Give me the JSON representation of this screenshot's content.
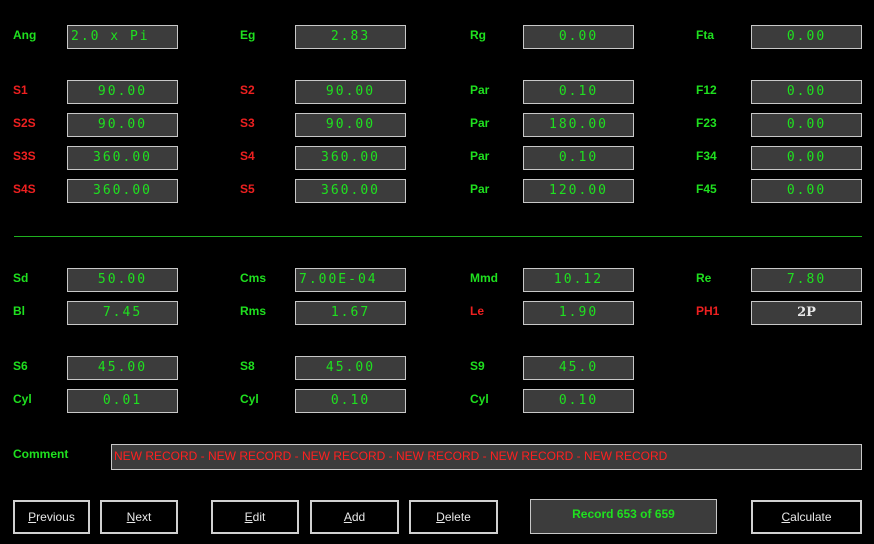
{
  "params": {
    "ang": {
      "label": "Ang",
      "value": "2.0 x Pi"
    },
    "eg": {
      "label": "Eg",
      "value": "2.83"
    },
    "rg": {
      "label": "Rg",
      "value": "0.00"
    },
    "fta": {
      "label": "Fta",
      "value": "0.00"
    },
    "s1": {
      "label": "S1",
      "value": "90.00"
    },
    "s2": {
      "label": "S2",
      "value": "90.00"
    },
    "par1": {
      "label": "Par",
      "value": "0.10"
    },
    "f12": {
      "label": "F12",
      "value": "0.00"
    },
    "s2s": {
      "label": "S2S",
      "value": "90.00"
    },
    "s3": {
      "label": "S3",
      "value": "90.00"
    },
    "par2": {
      "label": "Par",
      "value": "180.00"
    },
    "f23": {
      "label": "F23",
      "value": "0.00"
    },
    "s3s": {
      "label": "S3S",
      "value": "360.00"
    },
    "s4": {
      "label": "S4",
      "value": "360.00"
    },
    "par3": {
      "label": "Par",
      "value": "0.10"
    },
    "f34": {
      "label": "F34",
      "value": "0.00"
    },
    "s4s": {
      "label": "S4S",
      "value": "360.00"
    },
    "s5": {
      "label": "S5",
      "value": "360.00"
    },
    "par4": {
      "label": "Par",
      "value": "120.00"
    },
    "f45": {
      "label": "F45",
      "value": "0.00"
    },
    "sd": {
      "label": "Sd",
      "value": "50.00"
    },
    "cms": {
      "label": "Cms",
      "value": "7.00E-04"
    },
    "mmd": {
      "label": "Mmd",
      "value": "10.12"
    },
    "re": {
      "label": "Re",
      "value": "7.80"
    },
    "bl": {
      "label": "Bl",
      "value": "7.45"
    },
    "rms": {
      "label": "Rms",
      "value": "1.67"
    },
    "le": {
      "label": "Le",
      "value": "1.90"
    },
    "ph1": {
      "label": "PH1",
      "value": "2P"
    },
    "s6": {
      "label": "S6",
      "value": "45.00"
    },
    "s8": {
      "label": "S8",
      "value": "45.00"
    },
    "s9": {
      "label": "S9",
      "value": "45.0"
    },
    "cyl1": {
      "label": "Cyl",
      "value": "0.01"
    },
    "cyl2": {
      "label": "Cyl",
      "value": "0.10"
    },
    "cyl3": {
      "label": "Cyl",
      "value": "0.10"
    }
  },
  "comment": {
    "label": "Comment",
    "value": "NEW RECORD - NEW RECORD - NEW RECORD - NEW RECORD - NEW RECORD - NEW RECORD"
  },
  "buttons": {
    "previous": {
      "first": "P",
      "rest": "revious"
    },
    "next": {
      "first": "N",
      "rest": "ext"
    },
    "edit": {
      "first": "E",
      "rest": "dit"
    },
    "add": {
      "first": "A",
      "rest": "dd"
    },
    "delete": {
      "first": "D",
      "rest": "elete"
    },
    "calculate": {
      "first": "C",
      "rest": "alculate"
    }
  },
  "status": "Record 653 of 659",
  "colors": {
    "label_green": "#1fe01f",
    "label_red": "#ee2020",
    "field_bg": "#3c3c3c",
    "background": "#000000"
  }
}
